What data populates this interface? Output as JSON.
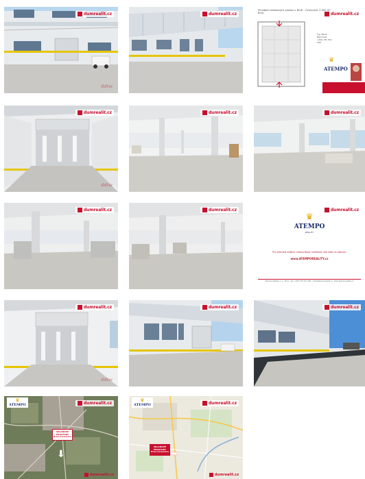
{
  "brand": {
    "name": "dumrealit.cz",
    "accent": "#c8102e",
    "watermark": "ddtw"
  },
  "gallery": {
    "tiles": [
      {
        "kind": "photo",
        "scene": "building-exterior-front"
      },
      {
        "kind": "photo",
        "scene": "building-exterior-canopy"
      },
      {
        "kind": "floorplan",
        "title": "Pronájem skladových prostor v Brně – Černovice, 2 000 m², Brno",
        "agent_name": "Ing. Pavla Němcová",
        "agent_phone": "+420 731 512 300"
      },
      {
        "kind": "photo",
        "scene": "garage-door-interior-view"
      },
      {
        "kind": "photo",
        "scene": "hall-interior-columns"
      },
      {
        "kind": "photo",
        "scene": "hall-interior-windows"
      },
      {
        "kind": "photo",
        "scene": "hall-interior-pallets"
      },
      {
        "kind": "photo",
        "scene": "hall-interior-pallets-2"
      },
      {
        "kind": "promo",
        "logo": "ATEMPO",
        "logo_sub": "REALITY",
        "line1": "Pro přehled dalších nemovitostí navštivte náš web na adrese:",
        "url": "www.ATEMPOREALITY.cz",
        "footer": "Atempo Reality s.r.o., Brno · tel. +420 731 512 300 · info@atemporeality.cz · www.atemporeality.cz"
      },
      {
        "kind": "photo",
        "scene": "garage-door-interior-view-2"
      },
      {
        "kind": "photo",
        "scene": "building-exterior-side"
      },
      {
        "kind": "photo",
        "scene": "building-exterior-sun"
      },
      {
        "kind": "map-satellite",
        "logo": "ATEMPO",
        "box": "SKLADOVÉ PROSTORY Brno-Černovice",
        "footer_brand": "dumrealit.cz"
      },
      {
        "kind": "map-street",
        "logo": "ATEMPO",
        "box": "SKLADOVÉ PROSTORY Brno-Černovice",
        "footer_brand": "dumrealit.cz"
      }
    ]
  },
  "icons": {
    "brand_mark": "dumrealit-logo-icon",
    "arrow": "arrow-down-icon",
    "crown": "crown-icon"
  },
  "colors": {
    "sky": "#b9d7ef",
    "wall": "#e9ecee",
    "floor": "#bdbdbb",
    "glass": "#7a8fa3",
    "yellow": "#e6c500"
  }
}
